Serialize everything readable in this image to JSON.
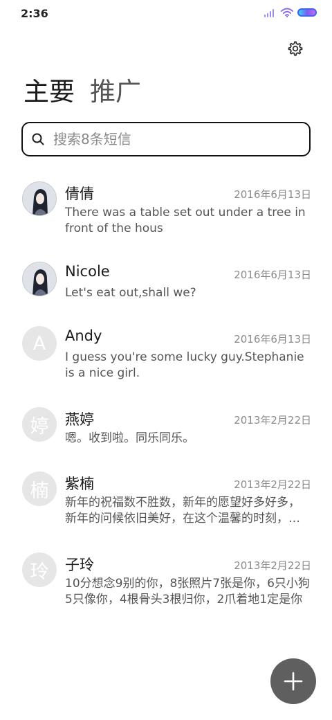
{
  "status_bar": {
    "time": "2:36"
  },
  "tabs": {
    "primary": "主要",
    "promo": "推广"
  },
  "search": {
    "placeholder": "搜索8条短信",
    "value": ""
  },
  "conversations": [
    {
      "name": "倩倩",
      "date": "2016年6月13日",
      "preview": "There was a table set out under a tree in front of the hous",
      "avatar": "photo"
    },
    {
      "name": "Nicole",
      "date": "2016年6月13日",
      "preview": "Let's eat out,shall we?",
      "avatar": "photo"
    },
    {
      "name": "Andy",
      "date": "2016年6月13日",
      "preview": "I guess you're some lucky guy.Stephanie is a nice girl.",
      "avatar": "A"
    },
    {
      "name": "燕婷",
      "date": "2013年2月22日",
      "preview": "嗯。收到啦。同乐同乐。",
      "avatar": "婷"
    },
    {
      "name": "紫楠",
      "date": "2013年2月22日",
      "preview": "新年的祝福数不胜数，新年的愿望好多好多，新年的问候依旧美好，在这个温馨的时刻，祝你新年快乐",
      "avatar": "楠"
    },
    {
      "name": "子玲",
      "date": "2013年2月22日",
      "preview": "10分想念9别的你，8张照片7张是你，6只小狗5只像你，4根骨头3根归你，2爪着地1定是你",
      "avatar": "玲"
    }
  ],
  "colors": {
    "fab": "#5f5f5f",
    "battery_border": "#3b64f2",
    "avatar_bg": "#e6e6e6"
  }
}
